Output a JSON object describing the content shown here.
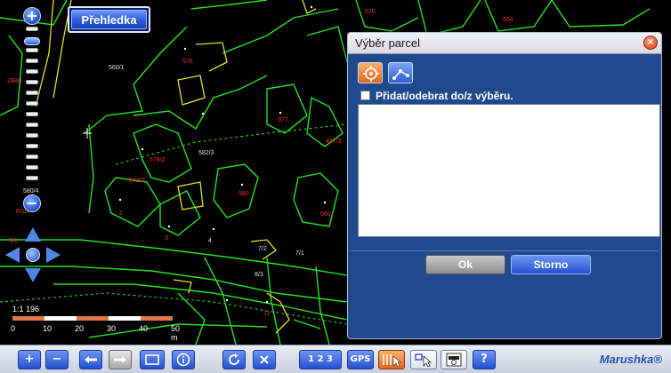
{
  "map": {
    "parcel_labels": [
      {
        "text": "560/1",
        "white": true,
        "pos": [
          122,
          73
        ]
      },
      {
        "text": "576",
        "white": false,
        "pos": [
          205,
          66
        ]
      },
      {
        "text": "570",
        "white": false,
        "pos": [
          410,
          10
        ]
      },
      {
        "text": "564",
        "white": false,
        "pos": [
          565,
          19
        ]
      },
      {
        "text": "558",
        "white": false,
        "pos": [
          593,
          44
        ]
      },
      {
        "text": "288/1",
        "white": false,
        "pos": [
          8,
          88
        ]
      },
      {
        "text": "577",
        "white": false,
        "pos": [
          312,
          132
        ]
      },
      {
        "text": "497/3",
        "white": false,
        "pos": [
          366,
          156
        ]
      },
      {
        "text": "578/2",
        "white": false,
        "pos": [
          168,
          177
        ]
      },
      {
        "text": "582/3",
        "white": true,
        "pos": [
          223,
          169
        ]
      },
      {
        "text": "542/2",
        "white": false,
        "pos": [
          145,
          200
        ]
      },
      {
        "text": "580",
        "white": false,
        "pos": [
          268,
          215
        ]
      },
      {
        "text": "560",
        "white": false,
        "pos": [
          360,
          238
        ]
      },
      {
        "text": "2",
        "white": false,
        "pos": [
          134,
          237
        ]
      },
      {
        "text": "3",
        "white": false,
        "pos": [
          185,
          265
        ]
      },
      {
        "text": "4",
        "white": true,
        "pos": [
          234,
          268
        ]
      },
      {
        "text": "7/2",
        "white": true,
        "pos": [
          290,
          277
        ]
      },
      {
        "text": "7/1",
        "white": true,
        "pos": [
          332,
          282
        ]
      },
      {
        "text": "8/3",
        "white": true,
        "pos": [
          286,
          306
        ]
      },
      {
        "text": "11",
        "white": false,
        "pos": [
          296,
          350
        ]
      },
      {
        "text": "6/10",
        "white": false,
        "pos": [
          18,
          235
        ]
      },
      {
        "text": "5/1",
        "white": false,
        "pos": [
          10,
          268
        ]
      },
      {
        "text": "580/4",
        "white": true,
        "pos": [
          26,
          212
        ]
      }
    ]
  },
  "zoom": {
    "plus_label": "+",
    "minus_label": "−",
    "level": 0.93
  },
  "overview_button": {
    "label": "Přehledka"
  },
  "scale": {
    "ratio": "1:1 196",
    "ticks": [
      "0",
      "10",
      "20",
      "30",
      "40",
      "50 m"
    ],
    "colors": [
      "#e07a4a",
      "#ffffff",
      "#e07a4a",
      "#ffffff",
      "#e07a4a"
    ]
  },
  "dialog": {
    "title": "Výběr parcel",
    "close_label": "×",
    "toggle_label": "Přidat/odebrat do/z výběru.",
    "ok_label": "Ok",
    "cancel_label": "Storno"
  },
  "toolbar": {
    "icons": [
      "zoom-in-icon",
      "zoom-out-icon",
      "back-icon",
      "forward-icon",
      "zoom-rect-icon",
      "info-icon",
      "refresh-icon",
      "clear-icon",
      "scale-select-icon",
      "gps-icon",
      "parcel-select-icon",
      "cursor-select-icon",
      "pdf-export-icon",
      "help-icon"
    ],
    "zoom_in_label": "+",
    "zoom_out_label": "−",
    "scale_label": "1 2 3",
    "gps_label": "GPS",
    "help_label": "?",
    "brand": "Marushka®"
  },
  "colors": {
    "map_background": "#000000",
    "parcel_line": "#21e321",
    "building_line": "#e8e020",
    "accent_blue": "#2a5bd6",
    "dialog_body": "#1f4a8e"
  }
}
